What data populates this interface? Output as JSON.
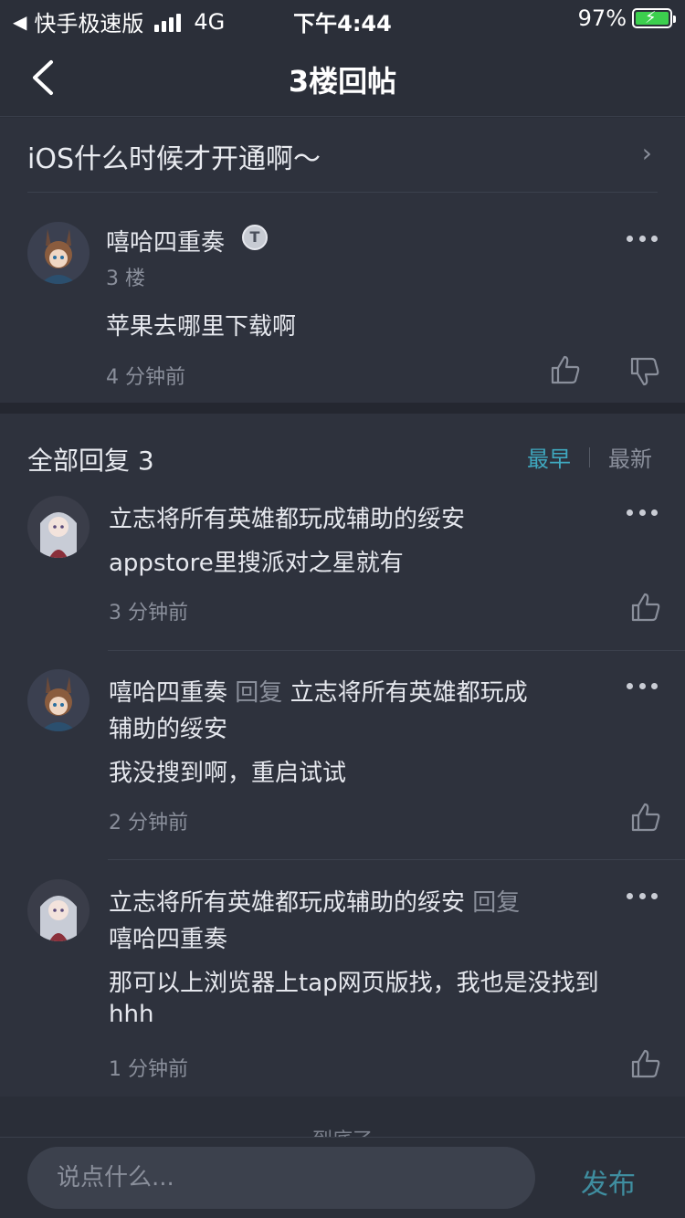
{
  "status": {
    "carrier": "快手极速版",
    "network": "4G",
    "time": "下午4:44",
    "battery": "97%"
  },
  "nav": {
    "title": "3楼回帖"
  },
  "thread": {
    "title": "iOS什么时候才开通啊～"
  },
  "post": {
    "author": "嘻哈四重奏",
    "badge": "T",
    "floor": "3 楼",
    "content": "苹果去哪里下载啊",
    "time": "4 分钟前"
  },
  "replies_header": {
    "title": "全部回复 3",
    "sort_earliest": "最早",
    "sort_latest": "最新"
  },
  "replies": [
    {
      "author": "立志将所有英雄都玩成辅助的绥安",
      "content": "appstore里搜派对之星就有",
      "time": "3 分钟前"
    },
    {
      "author": "嘻哈四重奏",
      "reply_label": "回复",
      "reply_target_line1": "立志将所有英雄都玩成",
      "reply_target_line2": "辅助的绥安",
      "content": "我没搜到啊，重启试试",
      "time": "2 分钟前"
    },
    {
      "author": "立志将所有英雄都玩成辅助的绥安",
      "reply_label": "回复",
      "reply_target": "嘻哈四重奏",
      "content_line1": "那可以上浏览器上tap网页版找，我也是没找到",
      "content_line2": "hhh",
      "time": "1 分钟前"
    }
  ],
  "end_text": "到底了",
  "composer": {
    "placeholder": "说点什么...",
    "publish": "发布"
  },
  "colors": {
    "accent": "#3fa8bf",
    "publish": "#3f8ea0",
    "background": "#2e323d"
  }
}
